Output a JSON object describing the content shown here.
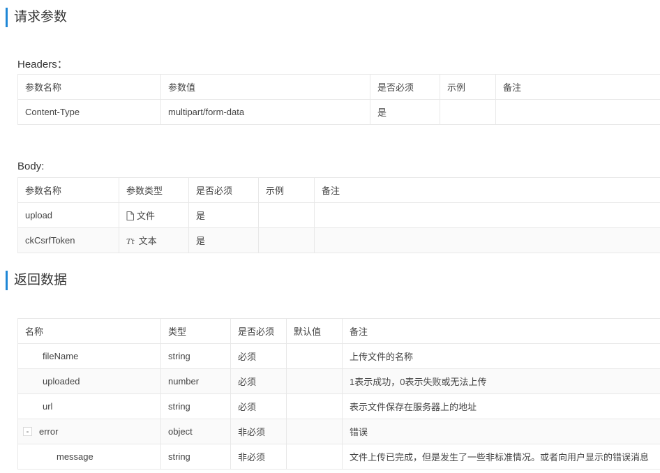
{
  "request_section": {
    "title": "请求参数"
  },
  "headers": {
    "title": "Headers：",
    "columns": [
      "参数名称",
      "参数值",
      "是否必须",
      "示例",
      "备注"
    ],
    "rows": [
      {
        "name": "Content-Type",
        "value": "multipart/form-data",
        "required": "是",
        "example": "",
        "note": ""
      }
    ]
  },
  "body": {
    "title": "Body:",
    "columns": [
      "参数名称",
      "参数类型",
      "是否必须",
      "示例",
      "备注"
    ],
    "rows": [
      {
        "name": "upload",
        "type_icon": "file-icon",
        "type": "文件",
        "required": "是",
        "example": "",
        "note": ""
      },
      {
        "name": "ckCsrfToken",
        "type_icon": "text-type-icon",
        "type_glyph": "Tt",
        "type": "文本",
        "required": "是",
        "example": "",
        "note": ""
      }
    ]
  },
  "response_section": {
    "title": "返回数据"
  },
  "response": {
    "columns": [
      "名称",
      "类型",
      "是否必须",
      "默认值",
      "备注"
    ],
    "rows": [
      {
        "name": "fileName",
        "type": "string",
        "required": "必须",
        "default": "",
        "note": "上传文件的名称"
      },
      {
        "name": "uploaded",
        "type": "number",
        "required": "必须",
        "default": "",
        "note": "1表示成功，0表示失败或无法上传"
      },
      {
        "name": "url",
        "type": "string",
        "required": "必须",
        "default": "",
        "note": "表示文件保存在服务器上的地址"
      },
      {
        "name": "error",
        "type": "object",
        "required": "非必须",
        "default": "",
        "note": "错误",
        "toggle": "-"
      },
      {
        "name": "message",
        "type": "string",
        "required": "非必须",
        "default": "",
        "note": "文件上传已完成，但是发生了一些非标准情况。或者向用户显示的错误消息"
      }
    ]
  }
}
